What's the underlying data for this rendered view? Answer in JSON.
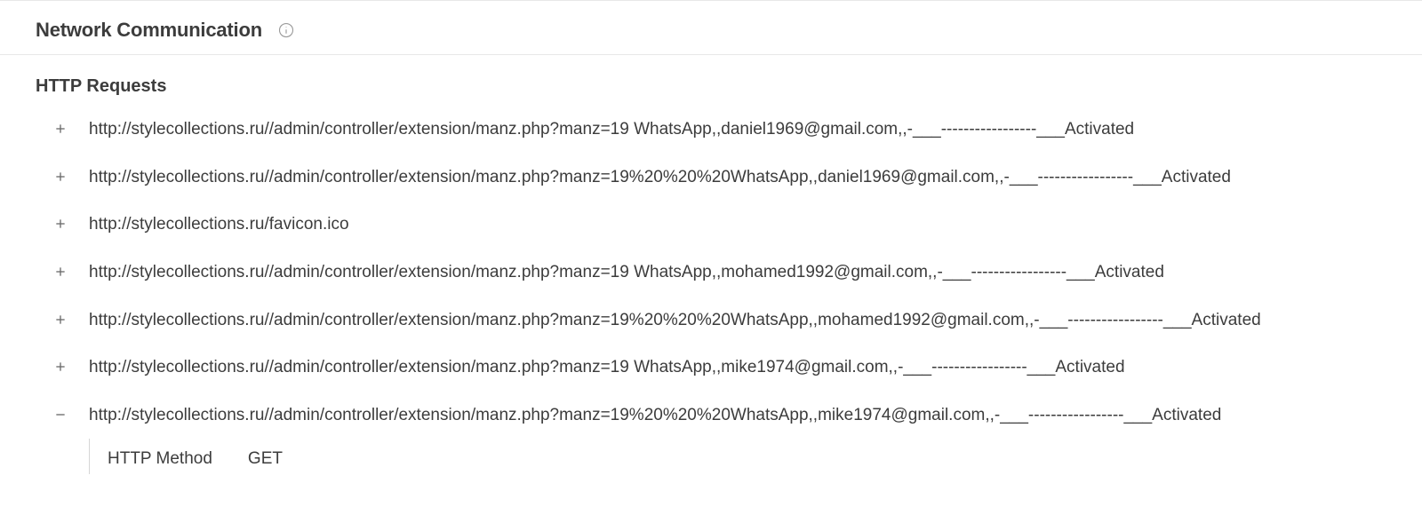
{
  "section": {
    "title": "Network Communication"
  },
  "http": {
    "title": "HTTP Requests",
    "requests": [
      {
        "expanded": false,
        "url": "http://stylecollections.ru//admin/controller/extension/manz.php?manz=19 WhatsApp,,daniel1969@gmail.com,,-___-----------------___Activated"
      },
      {
        "expanded": false,
        "url": "http://stylecollections.ru//admin/controller/extension/manz.php?manz=19%20%20%20WhatsApp,,daniel1969@gmail.com,,-___-----------------___Activated"
      },
      {
        "expanded": false,
        "url": "http://stylecollections.ru/favicon.ico"
      },
      {
        "expanded": false,
        "url": "http://stylecollections.ru//admin/controller/extension/manz.php?manz=19 WhatsApp,,mohamed1992@gmail.com,,-___-----------------___Activated"
      },
      {
        "expanded": false,
        "url": "http://stylecollections.ru//admin/controller/extension/manz.php?manz=19%20%20%20WhatsApp,,mohamed1992@gmail.com,,-___-----------------___Activated"
      },
      {
        "expanded": false,
        "url": "http://stylecollections.ru//admin/controller/extension/manz.php?manz=19 WhatsApp,,mike1974@gmail.com,,-___-----------------___Activated"
      },
      {
        "expanded": true,
        "url": "http://stylecollections.ru//admin/controller/extension/manz.php?manz=19%20%20%20WhatsApp,,mike1974@gmail.com,,-___-----------------___Activated",
        "details": {
          "method_label": "HTTP Method",
          "method_value": "GET"
        }
      }
    ]
  }
}
